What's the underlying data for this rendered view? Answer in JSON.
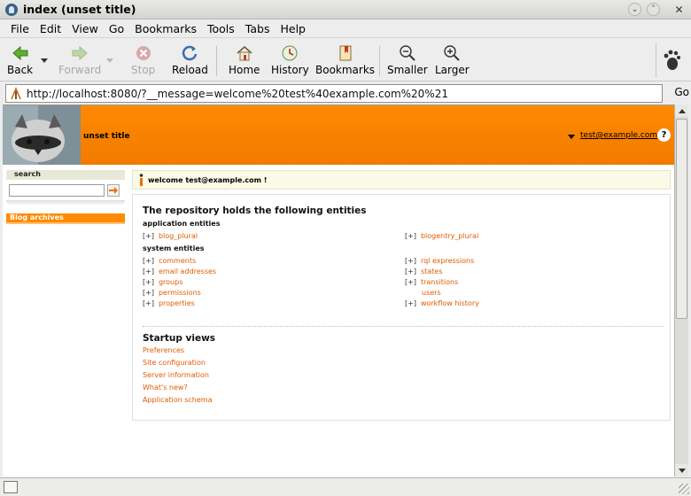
{
  "window": {
    "title": "index (unset title)"
  },
  "menu": [
    "File",
    "Edit",
    "View",
    "Go",
    "Bookmarks",
    "Tools",
    "Tabs",
    "Help"
  ],
  "toolbar": {
    "back": "Back",
    "forward": "Forward",
    "stop": "Stop",
    "reload": "Reload",
    "home": "Home",
    "history": "History",
    "bookmarks": "Bookmarks",
    "smaller": "Smaller",
    "larger": "Larger"
  },
  "urlbar": {
    "url": "http://localhost:8080/?__message=welcome%20test%40example.com%20%21",
    "go": "Go"
  },
  "header": {
    "site_title": "unset title",
    "user": "test@example.com",
    "help": "?"
  },
  "sidebar": {
    "search_title": "search",
    "blog_archives": "Blog archives"
  },
  "message": {
    "text": "welcome test@example.com !"
  },
  "main": {
    "heading": "The repository holds the following entities",
    "app_entities_title": "application entities",
    "app_entities": {
      "left": [
        "blog_plural"
      ],
      "right": [
        "blogentry_plural"
      ]
    },
    "system_entities_title": "system entities",
    "system_entities": {
      "left": [
        "comments",
        "email addresses",
        "groups",
        "permissions",
        "properties"
      ],
      "right": [
        "rql expressions",
        "states",
        "transitions",
        "users",
        "workflow history"
      ],
      "right_has_plus": [
        true,
        true,
        true,
        false,
        true
      ]
    },
    "plus_label": "[+]",
    "startup_title": "Startup views",
    "startup_links": [
      "Preferences",
      "Site configuration",
      "Server information",
      "What's new?",
      "Application schema"
    ]
  },
  "colors": {
    "accent": "#ff8a00",
    "link": "#e05c00"
  },
  "icons": [
    "back-arrow-icon",
    "forward-arrow-icon",
    "stop-icon",
    "reload-icon",
    "home-icon",
    "history-icon",
    "bookmarks-icon",
    "zoom-out-icon",
    "zoom-in-icon",
    "gnome-foot-icon",
    "info-icon",
    "help-icon"
  ]
}
